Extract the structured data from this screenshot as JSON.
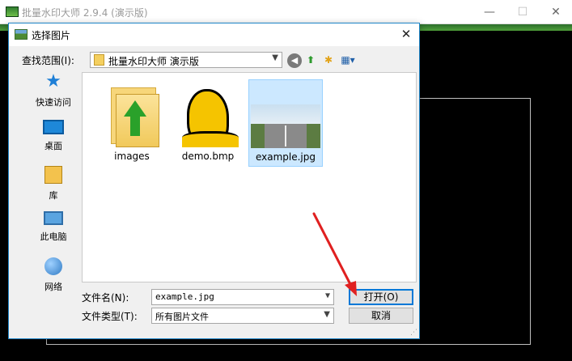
{
  "app": {
    "title": "批量水印大师 2.9.4 (演示版)",
    "minimize_glyph": "—",
    "maximize_glyph": "☐",
    "close_glyph": "✕"
  },
  "dialog": {
    "title": "选择图片",
    "close_glyph": "✕",
    "look_in_label": "查找范围(I):",
    "look_in_value": "批量水印大师 演示版",
    "toolbar": {
      "back_icon": "back-icon",
      "up_icon": "up-folder-icon",
      "new_folder_icon": "new-folder-icon",
      "view_menu_icon": "view-menu-icon"
    },
    "places": [
      {
        "label": "快速访问",
        "icon": "quick-access-icon"
      },
      {
        "label": "桌面",
        "icon": "desktop-icon"
      },
      {
        "label": "库",
        "icon": "library-icon"
      },
      {
        "label": "此电脑",
        "icon": "this-pc-icon"
      },
      {
        "label": "网络",
        "icon": "network-icon"
      }
    ],
    "files": [
      {
        "name": "images",
        "kind": "folder",
        "selected": false
      },
      {
        "name": "demo.bmp",
        "kind": "image",
        "selected": false
      },
      {
        "name": "example.jpg",
        "kind": "image",
        "selected": true
      }
    ],
    "filename_label": "文件名(N):",
    "filename_value": "example.jpg",
    "filetype_label": "文件类型(T):",
    "filetype_value": "所有图片文件",
    "open_button": "打开(O)",
    "cancel_button": "取消"
  },
  "colors": {
    "accent": "#0078d7",
    "selection": "#cce8ff",
    "annotation_arrow": "#e02020"
  }
}
